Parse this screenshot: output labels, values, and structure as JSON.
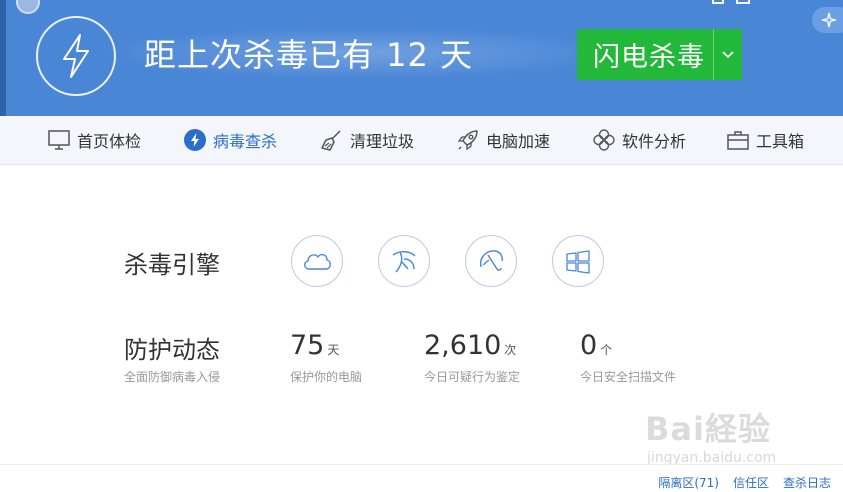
{
  "header": {
    "top_left_text": "",
    "headline": "距上次杀毒已有 12 天",
    "scan_button_label": "闪电杀毒"
  },
  "nav": {
    "items": [
      {
        "label": "首页体检",
        "icon": "monitor-icon",
        "active": false
      },
      {
        "label": "病毒查杀",
        "icon": "bolt-icon",
        "active": true
      },
      {
        "label": "清理垃圾",
        "icon": "broom-icon",
        "active": false
      },
      {
        "label": "电脑加速",
        "icon": "rocket-icon",
        "active": false
      },
      {
        "label": "软件分析",
        "icon": "flower-icon",
        "active": false
      },
      {
        "label": "工具箱",
        "icon": "toolbox-icon",
        "active": false
      }
    ]
  },
  "engine": {
    "label": "杀毒引擎",
    "icons": [
      "cloud-engine-icon",
      "system-repair-engine-icon",
      "umbrella-engine-icon",
      "windows-engine-icon"
    ]
  },
  "protection": {
    "label": "防护动态",
    "sublabel": "全面防御病毒入侵",
    "stats": [
      {
        "value": "75",
        "unit": "天",
        "desc": "保护你的电脑"
      },
      {
        "value": "2,610",
        "unit": "次",
        "desc": "今日可疑行为鉴定"
      },
      {
        "value": "0",
        "unit": "个",
        "desc": "今日安全扫描文件"
      }
    ]
  },
  "footer": {
    "quarantine": "隔离区(71)",
    "trust": "信任区",
    "log": "查杀日志"
  },
  "watermark": {
    "logo": "Bai経验",
    "url": "jingyan.baidu.com"
  },
  "colors": {
    "header_blue": "#4a86d6",
    "scan_green": "#22b83a",
    "active_blue": "#2b6dc7"
  }
}
